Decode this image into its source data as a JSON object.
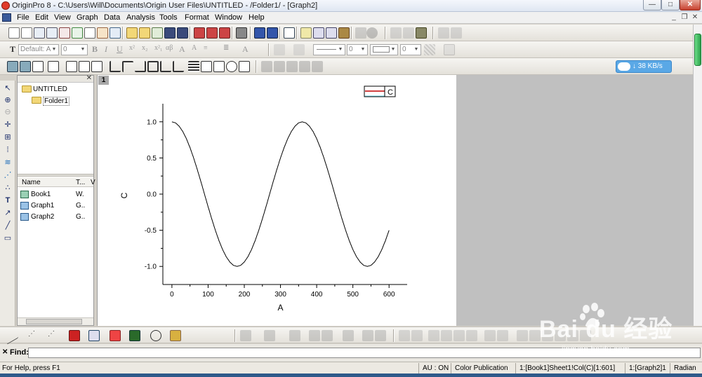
{
  "window": {
    "title": "OriginPro 8 - C:\\Users\\Will\\Documents\\Origin User Files\\UNTITLED - /Folder1/ - [Graph2]",
    "minimize_label": "—",
    "maximize_label": "□",
    "close_label": "✕"
  },
  "menu": {
    "items": [
      "File",
      "Edit",
      "View",
      "Graph",
      "Data",
      "Analysis",
      "Tools",
      "Format",
      "Window",
      "Help"
    ]
  },
  "format_toolbar": {
    "font_value": "Default: A",
    "size_value": "0",
    "line_width_value": "0",
    "pattern_value": "0"
  },
  "network_badge": {
    "text": "↓ 38 KB/s"
  },
  "explorer": {
    "close_label": "✕",
    "root": "UNTITLED",
    "folder": "Folder1",
    "columns": [
      "Name",
      "T...",
      "V"
    ],
    "rows": [
      {
        "name": "Book1",
        "type": "W."
      },
      {
        "name": "Graph1",
        "type": "G.."
      },
      {
        "name": "Graph2",
        "type": "G.."
      }
    ]
  },
  "graph": {
    "page_number": "1",
    "legend_label": "C",
    "line_color": "#000000",
    "legend_line_color": "#c00000"
  },
  "chart_data": {
    "type": "line",
    "title": "",
    "xlabel": "A",
    "ylabel": "C",
    "xlim": [
      -25,
      650
    ],
    "ylim": [
      -1.25,
      1.25
    ],
    "xticks": [
      0,
      100,
      200,
      300,
      400,
      500,
      600
    ],
    "yticks": [
      -1.0,
      -0.5,
      0.0,
      0.5,
      1.0
    ],
    "xtick_labels": [
      "0",
      "100",
      "200",
      "300",
      "400",
      "500",
      "600"
    ],
    "ytick_labels": [
      "-1.0",
      "-0.5",
      "0.0",
      "0.5",
      "1.0"
    ],
    "series": [
      {
        "name": "C",
        "x": [
          0,
          10,
          20,
          30,
          40,
          50,
          60,
          70,
          80,
          90,
          100,
          110,
          120,
          130,
          140,
          150,
          160,
          170,
          180,
          190,
          200,
          210,
          220,
          230,
          240,
          250,
          260,
          270,
          280,
          290,
          300,
          310,
          320,
          330,
          340,
          350,
          360,
          370,
          380,
          390,
          400,
          410,
          420,
          430,
          440,
          450,
          460,
          470,
          480,
          490,
          500,
          510,
          520,
          530,
          540,
          550,
          560,
          570,
          580,
          590,
          600
        ],
        "y": [
          1.0,
          0.985,
          0.939,
          0.866,
          0.766,
          0.643,
          0.5,
          0.342,
          0.174,
          0.0,
          -0.174,
          -0.342,
          -0.5,
          -0.643,
          -0.766,
          -0.866,
          -0.939,
          -0.985,
          -1.0,
          -0.985,
          -0.939,
          -0.866,
          -0.766,
          -0.643,
          -0.5,
          -0.342,
          -0.174,
          0.0,
          0.174,
          0.342,
          0.5,
          0.643,
          0.766,
          0.866,
          0.939,
          0.985,
          1.0,
          0.985,
          0.939,
          0.866,
          0.766,
          0.643,
          0.5,
          0.342,
          0.174,
          0.0,
          -0.174,
          -0.342,
          -0.5,
          -0.643,
          -0.766,
          -0.866,
          -0.939,
          -0.985,
          -1.0,
          -0.985,
          -0.939,
          -0.866,
          -0.766,
          -0.643,
          -0.5
        ]
      }
    ],
    "grid": false,
    "legend": "top-right"
  },
  "find": {
    "close_label": "✕",
    "label": "Find:",
    "value": ""
  },
  "status": {
    "help": "For Help, press F1",
    "au": "AU : ON",
    "theme": "Color Publication",
    "cell": "1:[Book1]Sheet1!Col(C)[1:601]",
    "layer": "1:[Graph2]1",
    "angle": "Radian"
  },
  "watermark": {
    "brand": "Bai du 经验",
    "url": "jingyan.baidu.com"
  }
}
